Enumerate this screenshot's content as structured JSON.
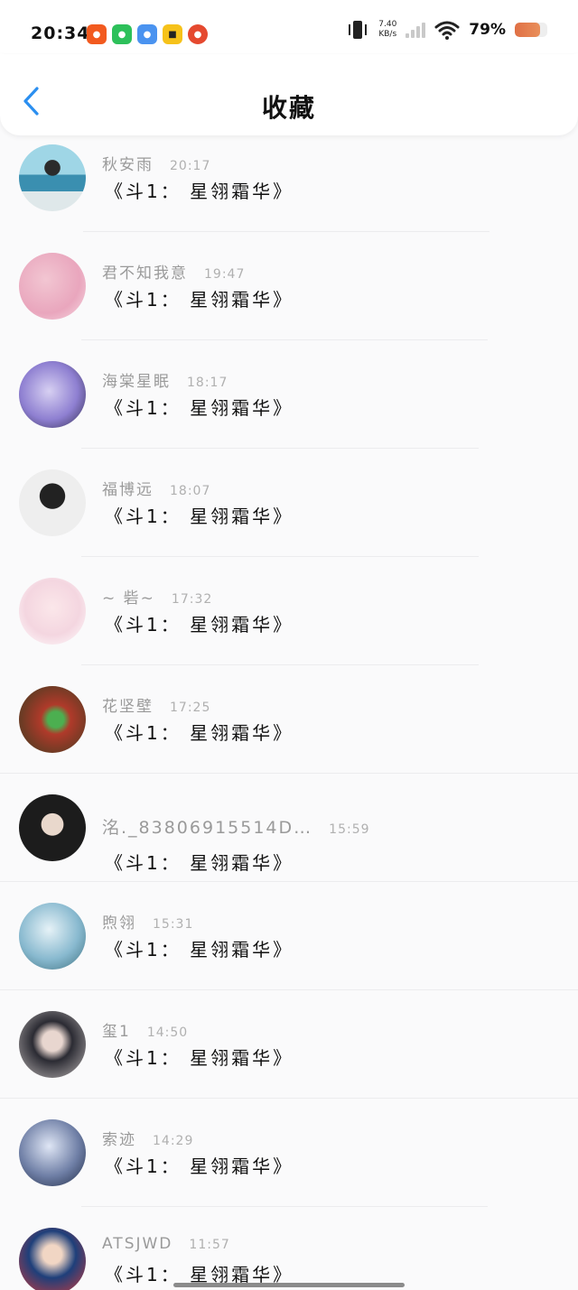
{
  "status": {
    "time": "20:34",
    "speed_value": "7.40",
    "speed_unit": "KB/s",
    "battery_pct": "79%",
    "battery_level": 0.79
  },
  "header": {
    "title": "收藏"
  },
  "icons": {
    "back": "chevron-left-icon",
    "apps": [
      "taobao-icon",
      "wechat-icon",
      "browser-icon",
      "meituan-icon",
      "app-icon"
    ]
  },
  "colors": {
    "accent": "#2b8ff0",
    "name": "#9a9a9a",
    "time": "#b0b0b0"
  },
  "items": [
    {
      "name": "秋安雨",
      "time": "20:17",
      "message": "《斗1： 星翎霜华》"
    },
    {
      "name": "君不知我意",
      "time": "19:47",
      "message": "《斗1： 星翎霜华》"
    },
    {
      "name": "海棠星眠",
      "time": "18:17",
      "message": "《斗1： 星翎霜华》"
    },
    {
      "name": "福博远",
      "time": "18:07",
      "message": "《斗1： 星翎霜华》"
    },
    {
      "name": "~ 砦~",
      "time": "17:32",
      "message": "《斗1： 星翎霜华》"
    },
    {
      "name": "花坚壁",
      "time": "17:25",
      "message": "《斗1： 星翎霜华》"
    },
    {
      "name": "洺._83806915514D…",
      "time": "15:59",
      "message": "《斗1： 星翎霜华》"
    },
    {
      "name": "煦翎",
      "time": "15:31",
      "message": "《斗1： 星翎霜华》"
    },
    {
      "name": "玺1",
      "time": "14:50",
      "message": "《斗1： 星翎霜华》"
    },
    {
      "name": "索迹",
      "time": "14:29",
      "message": "《斗1： 星翎霜华》"
    },
    {
      "name": "ATSJWD",
      "time": "11:57",
      "message": "《斗1： 星翎霜华》"
    }
  ]
}
